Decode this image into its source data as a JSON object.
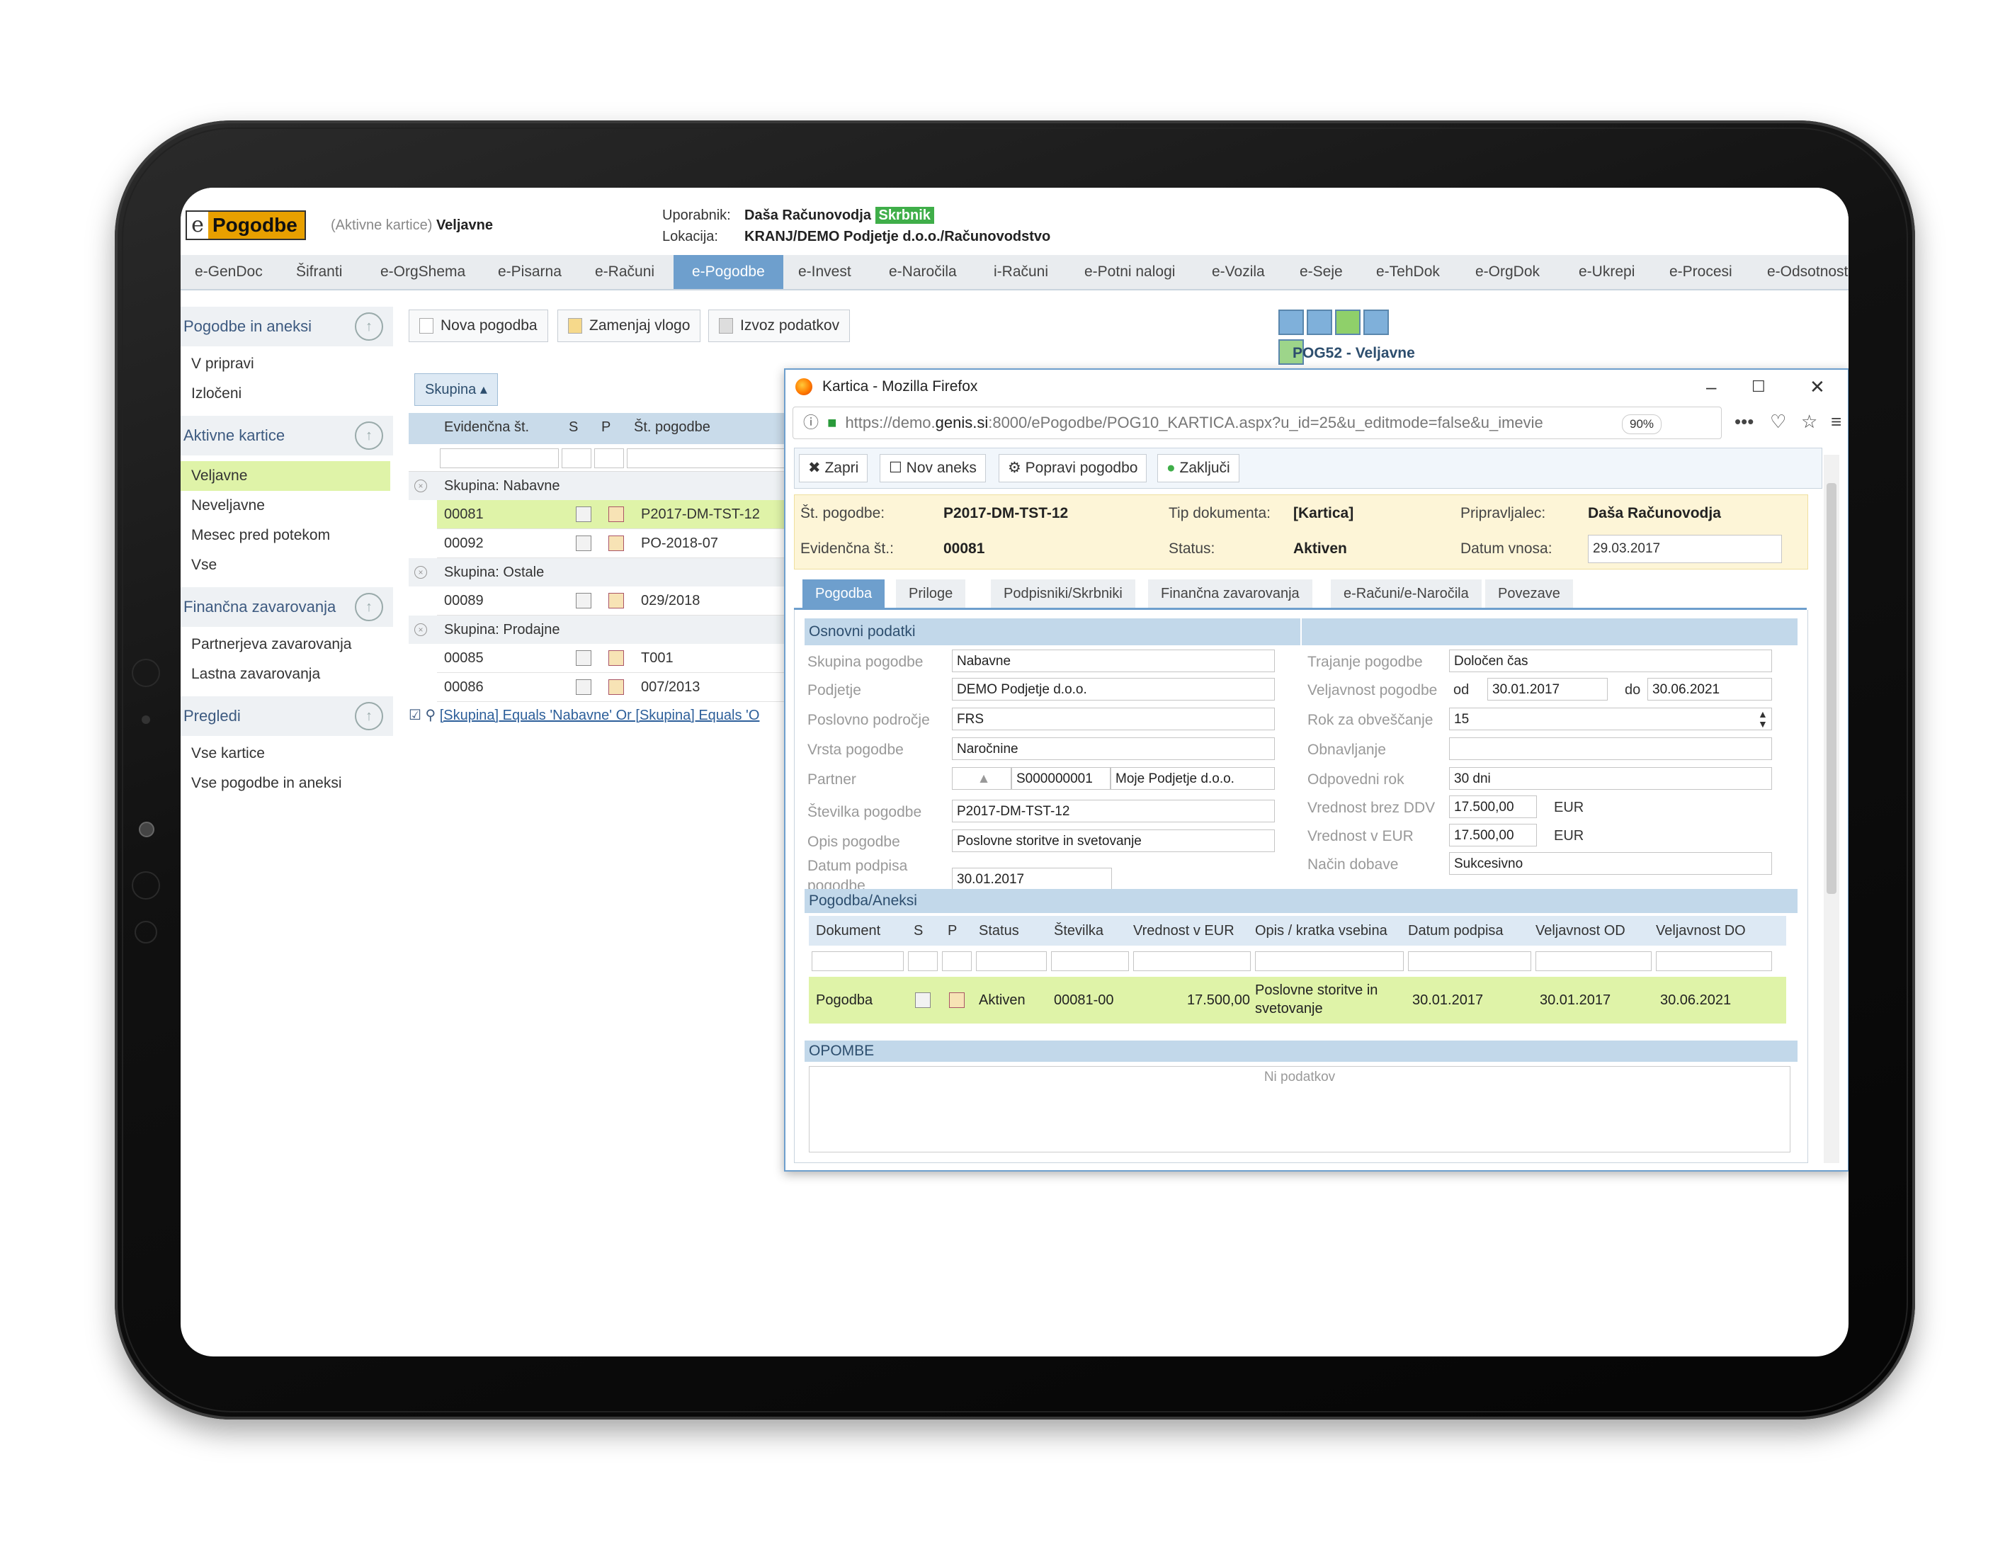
{
  "app": {
    "logo_e": "e",
    "logo_name": "Pogodbe",
    "context_prefix": "(Aktivne kartice)",
    "context_value": "Veljavne",
    "user_label": "Uporabnik:",
    "user_name": "Daša Računovodja",
    "user_role": "Skrbnik",
    "location_label": "Lokacija:",
    "location_value": "KRANJ/DEMO Podjetje d.o.o./Računovodstvo"
  },
  "nav": [
    "e-GenDoc",
    "Šifranti",
    "e-OrgShema",
    "e-Pisarna",
    "e-Računi",
    "e-Pogodbe",
    "e-Invest",
    "e-Naročila",
    "i-Računi",
    "e-Potni nalogi",
    "e-Vozila",
    "e-Seje",
    "e-TehDok",
    "e-OrgDok",
    "e-Ukrepi",
    "e-Procesi",
    "e-Odsotnost"
  ],
  "sidebar": {
    "sections": [
      {
        "title": "Pogodbe in aneksi",
        "items": [
          "V pripravi",
          "Izločeni"
        ]
      },
      {
        "title": "Aktivne kartice",
        "items": [
          "Veljavne",
          "Neveljavne",
          "Mesec pred potekom",
          "Vse"
        ]
      },
      {
        "title": "Finančna zavarovanja",
        "items": [
          "Partnerjeva zavarovanja",
          "Lastna zavarovanja"
        ]
      },
      {
        "title": "Pregledi",
        "items": [
          "Vse kartice",
          "Vse pogodbe in aneksi"
        ]
      }
    ]
  },
  "toolbar": {
    "new": "Nova pogodba",
    "swap": "Zamenjaj vlogo",
    "export": "Izvoz podatkov",
    "screen_title": "POG52 - Veljavne"
  },
  "grid": {
    "group_chip": "Skupina",
    "columns": [
      "Evidenčna št.",
      "S",
      "P",
      "Št. pogodbe"
    ],
    "groups": [
      {
        "label": "Skupina: Nabavne",
        "rows": [
          {
            "ev": "00081",
            "st": "P2017-DM-TST-12"
          },
          {
            "ev": "00092",
            "st": "PO-2018-07"
          }
        ]
      },
      {
        "label": "Skupina: Ostale",
        "rows": [
          {
            "ev": "00089",
            "st": "029/2018"
          }
        ]
      },
      {
        "label": "Skupina: Prodajne",
        "rows": [
          {
            "ev": "00085",
            "st": "T001"
          },
          {
            "ev": "00086",
            "st": "007/2013"
          }
        ]
      }
    ],
    "filter_text": "[Skupina] Equals 'Nabavne' Or [Skupina] Equals 'O"
  },
  "browser": {
    "title": "Kartica - Mozilla Firefox",
    "url_prefix": "https://demo.",
    "url_host": "genis.si",
    "url_rest": ":8000/ePogodbe/POG10_KARTICA.aspx?u_id=25&u_editmode=false&u_imevie",
    "zoom": "90%"
  },
  "card": {
    "buttons": {
      "close": "Zapri",
      "annex": "Nov aneks",
      "edit": "Popravi pogodbo",
      "finish": "Zaključi"
    },
    "info": {
      "st_label": "Št. pogodbe:",
      "st_value": "P2017-DM-TST-12",
      "ev_label": "Evidenčna št.:",
      "ev_value": "00081",
      "tip_label": "Tip dokumenta:",
      "tip_value": "[Kartica]",
      "status_label": "Status:",
      "status_value": "Aktiven",
      "prip_label": "Pripravljalec:",
      "prip_value": "Daša Računovodja",
      "datum_label": "Datum vnosa:",
      "datum_value": "29.03.2017"
    },
    "tabs": [
      "Pogodba",
      "Priloge",
      "Podpisniki/Skrbniki",
      "Finančna zavarovanja",
      "e-Računi/e-Naročila",
      "Povezave"
    ],
    "section_basic": "Osnovni podatki",
    "left_fields": [
      {
        "label": "Skupina pogodbe",
        "value": "Nabavne"
      },
      {
        "label": "Podjetje",
        "value": "DEMO Podjetje d.o.o."
      },
      {
        "label": "Poslovno področje",
        "value": "FRS"
      },
      {
        "label": "Vrsta pogodbe",
        "value": "Naročnine"
      },
      {
        "label": "Partner",
        "code": "S000000001",
        "value": "Moje Podjetje d.o.o."
      },
      {
        "label": "Številka pogodbe",
        "value": "P2017-DM-TST-12"
      },
      {
        "label": "Opis pogodbe",
        "value": "Poslovne storitve in svetovanje"
      },
      {
        "label": "Datum podpisa pogodbe",
        "value": "30.01.2017"
      }
    ],
    "right_fields": {
      "trajanje_label": "Trajanje pogodbe",
      "trajanje_value": "Določen čas",
      "velj_label": "Veljavnost pogodbe",
      "od": "od",
      "od_value": "30.01.2017",
      "do": "do",
      "do_value": "30.06.2021",
      "rok_label": "Rok za obveščanje",
      "rok_value": "15",
      "obn_label": "Obnavljanje",
      "obn_value": "",
      "odp_label": "Odpovedni rok",
      "odp_value": "30 dni",
      "brez_label": "Vrednost brez DDV",
      "brez_value": "17.500,00",
      "brez_cur": "EUR",
      "eur_label": "Vrednost v EUR",
      "eur_value": "17.500,00",
      "eur_cur": "EUR",
      "nacin_label": "Način dobave",
      "nacin_value": "Sukcesivno"
    },
    "section_annex": "Pogodba/Aneksi",
    "annex_columns": [
      "Dokument",
      "S",
      "P",
      "Status",
      "Številka",
      "Vrednost v EUR",
      "Opis / kratka vsebina",
      "Datum podpisa",
      "Veljavnost OD",
      "Veljavnost DO"
    ],
    "annex_row": {
      "doc": "Pogodba",
      "status": "Aktiven",
      "st": "00081-00",
      "val": "17.500,00",
      "opis1": "Poslovne storitve in",
      "opis2": "svetovanje",
      "dp": "30.01.2017",
      "od": "30.01.2017",
      "do": "30.06.2021"
    },
    "section_notes": "OPOMBE",
    "no_data": "Ni podatkov"
  }
}
